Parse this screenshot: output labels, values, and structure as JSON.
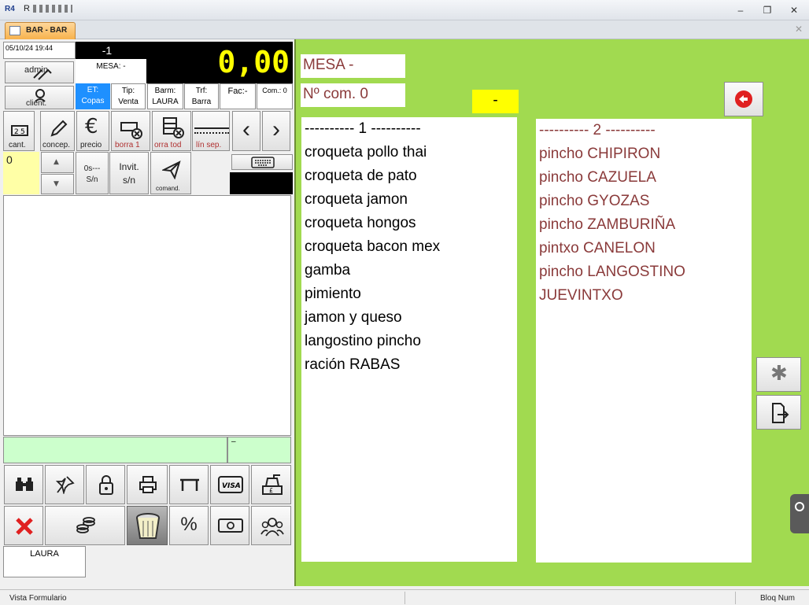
{
  "window": {
    "logo": "R4",
    "title": "R",
    "minimize": "–",
    "restore": "❐",
    "close": "✕"
  },
  "tab": {
    "label": "BAR - BAR",
    "close": "✕"
  },
  "header": {
    "datetime": "05/10/24 19:44",
    "top_number": "-1",
    "total": "0,00",
    "mesa": "MESA: -"
  },
  "left_buttons": {
    "admin": "admin",
    "client": "client."
  },
  "info": {
    "et_label": "ET:",
    "et_value": "Copas",
    "tip_label": "Tip:",
    "tip_value": "Venta",
    "barm_label": "Barm:",
    "barm_value": "LAURA",
    "trf_label": "Trf:",
    "trf_value": "Barra",
    "fac": "Fac:-",
    "com": "Com.: 0"
  },
  "tools": {
    "cant": "cant.",
    "concep": "concep.",
    "precio": "precio",
    "borra1": "borra 1",
    "borratod": "orra tod",
    "linsep": "lín sep.",
    "prev": "‹",
    "next": "›"
  },
  "qty": {
    "value": "0",
    "os": "0s---",
    "sn": "S/n",
    "invit": "Invit.",
    "invit_sn": "s/n",
    "comand": "comand."
  },
  "strip": {
    "right": "–"
  },
  "bottom": {
    "user": "LAURA",
    "percent": "%"
  },
  "right": {
    "mesa": "MESA -",
    "ncom": "Nº com. 0",
    "yellow": "-"
  },
  "col1": {
    "header": "---------- 1 ----------",
    "items": [
      "croqueta pollo thai",
      "croqueta de pato",
      "croqueta jamon",
      "croqueta hongos",
      "croqueta bacon mex",
      "gamba",
      "pimiento",
      "jamon y queso",
      "langostino pincho",
      "ración RABAS"
    ]
  },
  "col2": {
    "header": "---------- 2 ----------",
    "items": [
      "pincho CHIPIRON",
      "pincho CAZUELA",
      "pincho GYOZAS",
      "pincho ZAMBURIÑA",
      "pintxo CANELON",
      "pincho LANGOSTINO",
      "JUEVINTXO"
    ]
  },
  "status": {
    "left": "Vista Formulario",
    "right": "Bloq Num"
  },
  "colors": {
    "green_pane": "#a1da50",
    "maroon": "#8a3a3a",
    "yellow": "#ffff00",
    "lcd": "#000000",
    "selected_blue": "#1e90ff"
  }
}
